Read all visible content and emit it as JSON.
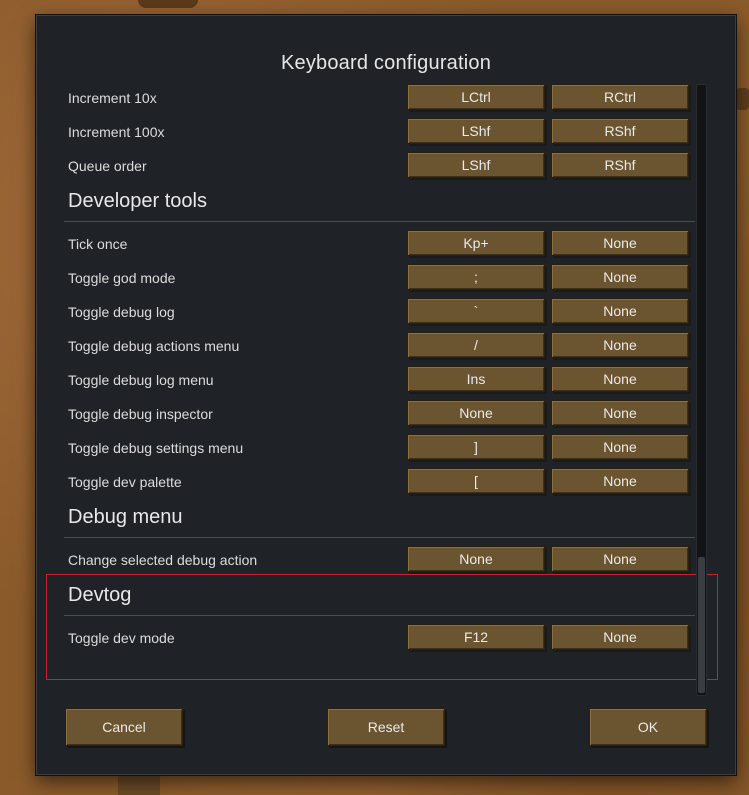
{
  "dialog": {
    "title": "Keyboard configuration"
  },
  "rows_top": [
    {
      "label": "Increment 10x",
      "primary": "LCtrl",
      "secondary": "RCtrl"
    },
    {
      "label": "Increment 100x",
      "primary": "LShf",
      "secondary": "RShf"
    },
    {
      "label": "Queue order",
      "primary": "LShf",
      "secondary": "RShf"
    }
  ],
  "sections": [
    {
      "title": "Developer tools",
      "rows": [
        {
          "label": "Tick once",
          "primary": "Kp+",
          "secondary": "None"
        },
        {
          "label": "Toggle god mode",
          "primary": ";",
          "secondary": "None"
        },
        {
          "label": "Toggle debug log",
          "primary": "`",
          "secondary": "None"
        },
        {
          "label": "Toggle debug actions menu",
          "primary": "/",
          "secondary": "None"
        },
        {
          "label": "Toggle debug log menu",
          "primary": "Ins",
          "secondary": "None"
        },
        {
          "label": "Toggle debug inspector",
          "primary": "None",
          "secondary": "None"
        },
        {
          "label": "Toggle debug settings menu",
          "primary": "]",
          "secondary": "None"
        },
        {
          "label": "Toggle dev palette",
          "primary": "[",
          "secondary": "None"
        }
      ]
    },
    {
      "title": "Debug menu",
      "rows": [
        {
          "label": "Change selected debug action",
          "primary": "None",
          "secondary": "None"
        }
      ]
    },
    {
      "title": "Devtog",
      "rows": [
        {
          "label": "Toggle dev mode",
          "primary": "F12",
          "secondary": "None"
        }
      ]
    }
  ],
  "footer": {
    "cancel_label": "Cancel",
    "reset_label": "Reset",
    "ok_label": "OK"
  },
  "colors": {
    "dialog_bg": "#1f2327",
    "button_bg": "#6b5430",
    "highlight": "#c8232c",
    "backdrop": "#8a5a2a"
  }
}
